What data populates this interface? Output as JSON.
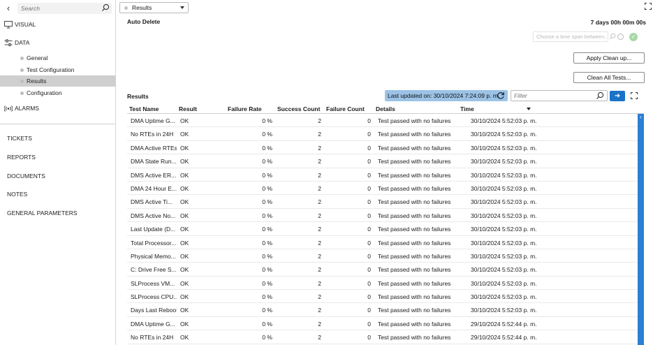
{
  "sidebar": {
    "search_placeholder": "Search",
    "nav": {
      "visual": "VISUAL",
      "data": "DATA",
      "alarms": "ALARMS"
    },
    "data_items": [
      "General",
      "Test Configuration",
      "Results",
      "Configuration"
    ],
    "active_item": "Results",
    "bottom_items": [
      "TICKETS",
      "REPORTS",
      "DOCUMENTS",
      "NOTES",
      "GENERAL PARAMETERS"
    ]
  },
  "header": {
    "view_select": "Results",
    "auto_delete_label": "Auto Delete",
    "duration": "7 days 00h 00m 00s",
    "timespan_placeholder": "Choose a time span between...",
    "apply_button": "Apply Clean up...",
    "clean_all_button": "Clean All Tests..."
  },
  "results": {
    "title": "Results",
    "last_updated": "Last updated on: 30/10/2024 7:24:09 p. m.",
    "filter_placeholder": "Filter",
    "columns": [
      "Test Name",
      "Result",
      "Failure Rate",
      "Success Count",
      "Failure Count",
      "Details",
      "Time"
    ],
    "rows": [
      [
        "DMA Uptime G...",
        "OK",
        "0 %",
        "2",
        "0",
        "Test passed with no failures",
        "30/10/2024 5:52:03 p. m."
      ],
      [
        "No RTEs in 24H",
        "OK",
        "0 %",
        "2",
        "0",
        "Test passed with no failures",
        "30/10/2024 5:52:03 p. m."
      ],
      [
        "DMA Active RTEs",
        "OK",
        "0 %",
        "2",
        "0",
        "Test passed with no failures",
        "30/10/2024 5:52:03 p. m."
      ],
      [
        "DMA State Run...",
        "OK",
        "0 %",
        "2",
        "0",
        "Test passed with no failures",
        "30/10/2024 5:52:03 p. m."
      ],
      [
        "DMS Active ER...",
        "OK",
        "0 %",
        "2",
        "0",
        "Test passed with no failures",
        "30/10/2024 5:52:03 p. m."
      ],
      [
        "DMA 24 Hour E...",
        "OK",
        "0 %",
        "2",
        "0",
        "Test passed with no failures",
        "30/10/2024 5:52:03 p. m."
      ],
      [
        "DMS Active Ti...",
        "OK",
        "0 %",
        "2",
        "0",
        "Test passed with no failures",
        "30/10/2024 5:52:03 p. m."
      ],
      [
        "DMS Active No...",
        "OK",
        "0 %",
        "2",
        "0",
        "Test passed with no failures",
        "30/10/2024 5:52:03 p. m."
      ],
      [
        "Last Update (D...",
        "OK",
        "0 %",
        "2",
        "0",
        "Test passed with no failures",
        "30/10/2024 5:52:03 p. m."
      ],
      [
        "Total Processor...",
        "OK",
        "0 %",
        "2",
        "0",
        "Test passed with no failures",
        "30/10/2024 5:52:03 p. m."
      ],
      [
        "Physical Memo...",
        "OK",
        "0 %",
        "2",
        "0",
        "Test passed with no failures",
        "30/10/2024 5:52:03 p. m."
      ],
      [
        "C: Drive Free S...",
        "OK",
        "0 %",
        "2",
        "0",
        "Test passed with no failures",
        "30/10/2024 5:52:03 p. m."
      ],
      [
        "SLProcess VM...",
        "OK",
        "0 %",
        "2",
        "0",
        "Test passed with no failures",
        "30/10/2024 5:52:03 p. m."
      ],
      [
        "SLProcess CPU...",
        "OK",
        "0 %",
        "2",
        "0",
        "Test passed with no failures",
        "30/10/2024 5:52:03 p. m."
      ],
      [
        "Days Last Reboot",
        "OK",
        "0 %",
        "2",
        "0",
        "Test passed with no failures",
        "30/10/2024 5:52:03 p. m."
      ],
      [
        "DMA Uptime G...",
        "OK",
        "0 %",
        "2",
        "0",
        "Test passed with no failures",
        "29/10/2024 5:52:44 p. m."
      ],
      [
        "No RTEs in 24H",
        "OK",
        "0 %",
        "2",
        "0",
        "Test passed with no failures",
        "29/10/2024 5:52:44 p. m."
      ]
    ]
  },
  "colors": {
    "accent": "#1a73c8",
    "last_updated_bg": "#9cc3e6",
    "active_nav_bg": "#cfcfcf",
    "success_check": "#a7d8a9"
  }
}
